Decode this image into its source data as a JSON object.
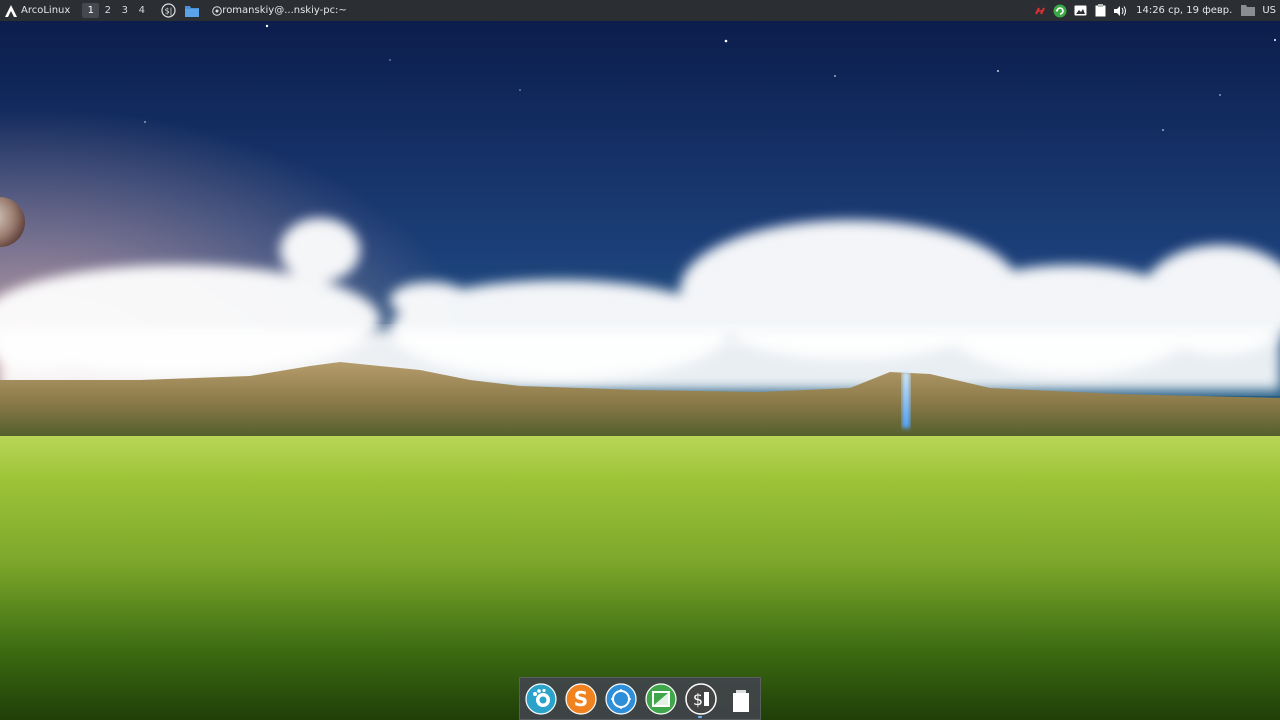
{
  "panel": {
    "menu_label": "ArcoLinux",
    "workspaces": [
      "1",
      "2",
      "3",
      "4"
    ],
    "active_workspace": "1",
    "task_title": "romanskiy@...nskiy-pc:~",
    "pinned_icons": [
      "terminal-dollar-icon",
      "file-manager-folder-icon"
    ]
  },
  "tray": {
    "icons": [
      "network-disconnected-icon",
      "update-manager-icon",
      "screenshot-icon",
      "clipboard-icon",
      "volume-icon"
    ],
    "clock": "14:26 ср, 19 февр.",
    "keyboard_layout": "US"
  },
  "dock": {
    "items": [
      "gimp-icon",
      "sublime-text-icon",
      "web-browser-icon",
      "system-monitor-icon",
      "terminal-icon",
      "trash-icon"
    ],
    "colors": {
      "gimp": "#2aa2c9",
      "sublime": "#f0831f",
      "browser": "#2e8fd8",
      "monitor": "#3fa64a",
      "terminal": "#444444"
    }
  },
  "colors": {
    "panel_bg": "#2b2e33",
    "sky_top": "#0b1d4d",
    "sky_mid": "#2a6a8f",
    "grass": "#7fae2c"
  }
}
